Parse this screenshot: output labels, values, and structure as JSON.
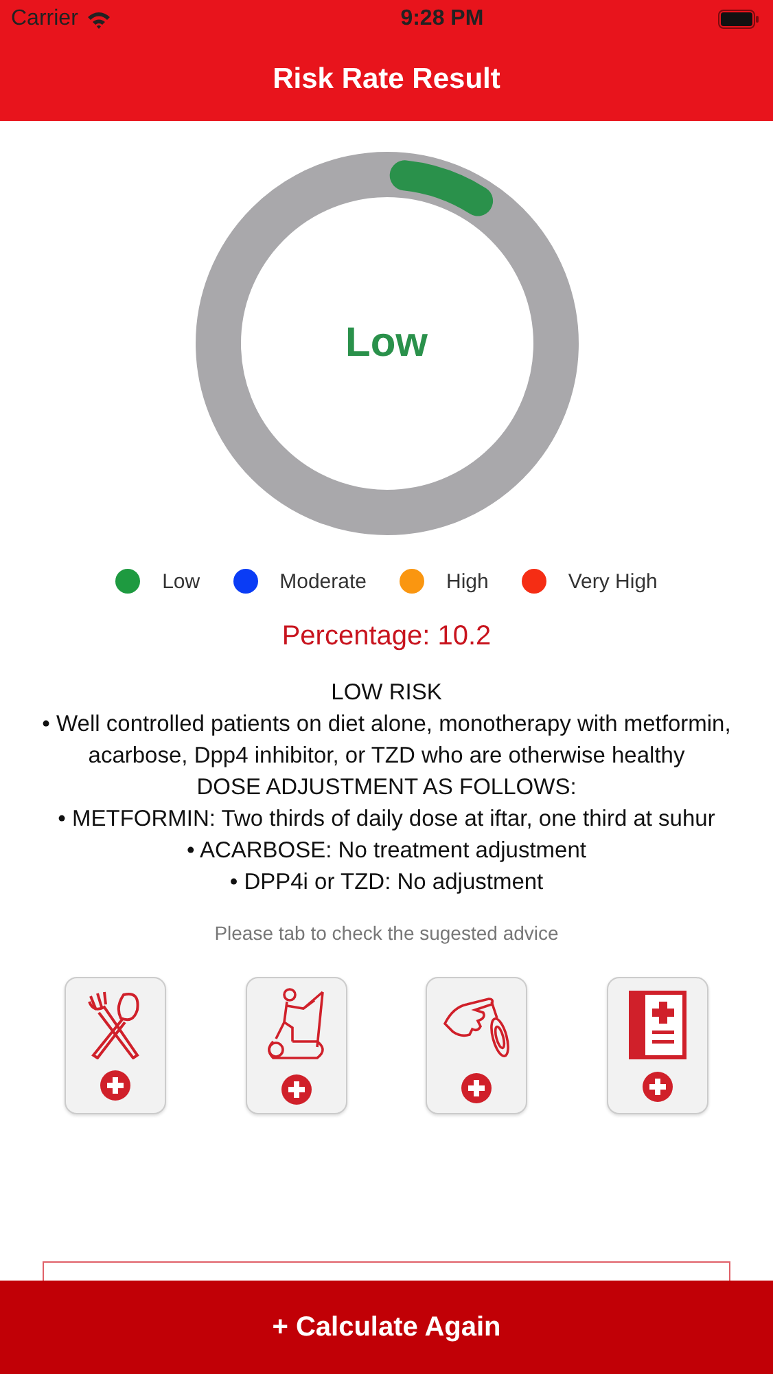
{
  "status_bar": {
    "carrier": "Carrier",
    "time": "9:28 PM"
  },
  "nav": {
    "title": "Risk Rate Result"
  },
  "gauge": {
    "label": "Low",
    "level": 0.102,
    "color": "#2a914b"
  },
  "legend": [
    {
      "label": "Low",
      "color": "#1e9a40"
    },
    {
      "label": "Moderate",
      "color": "#0a3cf5"
    },
    {
      "label": "High",
      "color": "#fa9610"
    },
    {
      "label": "Very High",
      "color": "#f52d14"
    }
  ],
  "percentage": "Percentage: 10.2",
  "advice": [
    "LOW RISK",
    "• Well controlled patients on diet alone, monotherapy with metformin, acarbose, Dpp4 inhibitor, or TZD who are otherwise healthy",
    "DOSE ADJUSTMENT AS FOLLOWS:",
    "• METFORMIN: Two thirds of daily dose at iftar, one third at suhur",
    "• ACARBOSE: No treatment adjustment",
    "• DPP4i or TZD: No adjustment"
  ],
  "hint": "Please tab to check the sugested advice",
  "advice_cards": [
    {
      "kind": "diet"
    },
    {
      "kind": "exercise"
    },
    {
      "kind": "hypnosis"
    },
    {
      "kind": "medical"
    }
  ],
  "calculate_button": "+ Calculate Again"
}
